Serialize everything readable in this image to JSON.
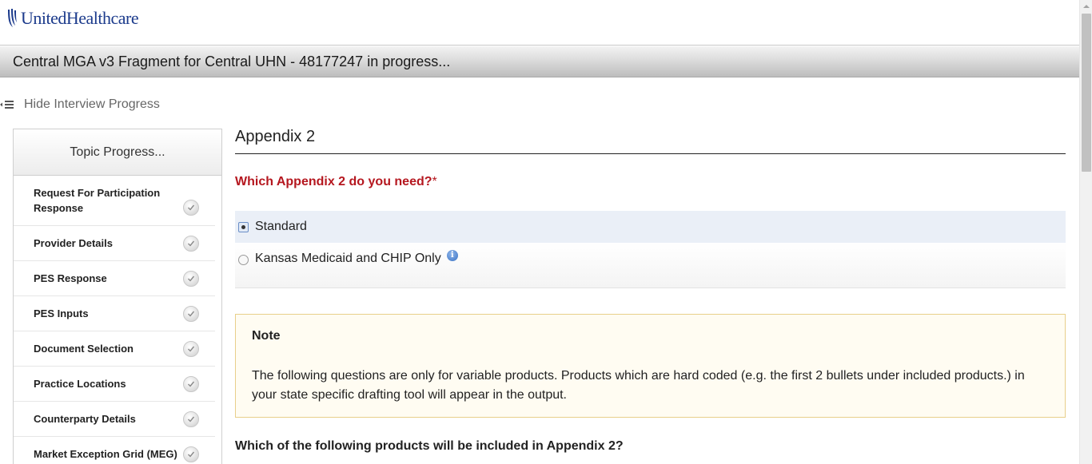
{
  "header": {
    "brand": "UnitedHealthcare",
    "title": "Central MGA v3 Fragment for Central UHN - 48177247 in progress..."
  },
  "progress_toggle": {
    "label": "Hide Interview Progress"
  },
  "sidebar": {
    "title": "Topic Progress...",
    "items": [
      {
        "label": "Request For Participation Response"
      },
      {
        "label": "Provider Details"
      },
      {
        "label": "PES Response"
      },
      {
        "label": "PES Inputs"
      },
      {
        "label": "Document Selection"
      },
      {
        "label": "Practice Locations"
      },
      {
        "label": "Counterparty Details"
      },
      {
        "label": "Market Exception Grid (MEG)"
      }
    ]
  },
  "main": {
    "section_title": "Appendix 2",
    "question": "Which Appendix 2 do you need?",
    "required_marker": "*",
    "options": [
      {
        "label": "Standard",
        "selected": true
      },
      {
        "label": "Kansas Medicaid and CHIP Only",
        "selected": false,
        "info_icon": "i"
      }
    ],
    "note": {
      "title": "Note",
      "body": "The following questions are only for variable products. Products which are hard coded (e.g. the first 2 bullets under included products.) in your state specific drafting tool will appear in the output."
    },
    "question2": "Which of the following products will be included in Appendix 2?"
  },
  "colors": {
    "brand_blue": "#1c3b8c",
    "question_red": "#b5171f",
    "note_border": "#e8cf8a",
    "note_background": "#fffcf2",
    "selected_option_bg": "#eaeff7"
  }
}
